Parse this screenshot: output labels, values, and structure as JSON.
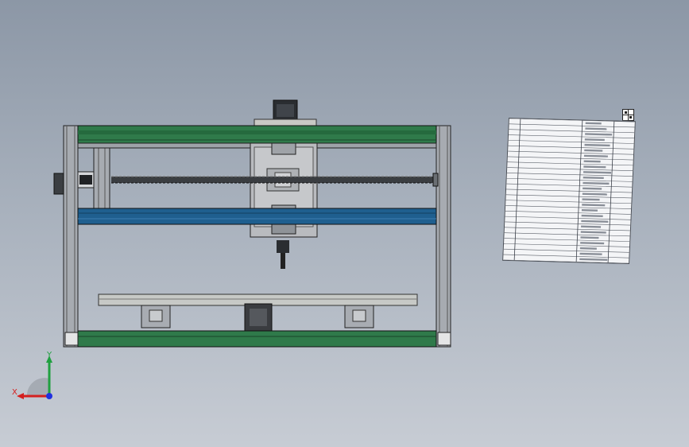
{
  "triad": {
    "x_label": "X",
    "y_label": "Y"
  },
  "colors": {
    "rail_green": "#2f7a4a",
    "rail_blue": "#1f5f8f",
    "frame_gray": "#8a8e94",
    "x_axis": "#d42020",
    "y_axis": "#20a040",
    "z_axis": "#2030e0"
  },
  "icons": {
    "bom_expand": "plus-grid-icon"
  },
  "bom_table": {
    "row_count": 26
  }
}
